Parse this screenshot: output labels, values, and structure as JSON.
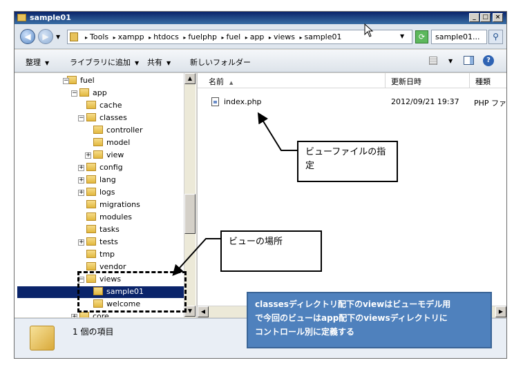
{
  "window": {
    "title": "sample01",
    "controls": [
      "_",
      "□",
      "×"
    ]
  },
  "address": {
    "crumbs": [
      "Tools",
      "xampp",
      "htdocs",
      "fuelphp",
      "fuel",
      "app",
      "views",
      "sample01"
    ],
    "search_text": "sample01..."
  },
  "toolbar": {
    "organize": "整理",
    "add_to_library": "ライブラリに追加",
    "share": "共有",
    "new_folder": "新しいフォルダー"
  },
  "tree": [
    {
      "label": "fuel",
      "expander": "−"
    },
    {
      "label": "app",
      "expander": "−"
    },
    {
      "label": "cache",
      "expander": ""
    },
    {
      "label": "classes",
      "expander": "−"
    },
    {
      "label": "controller",
      "expander": ""
    },
    {
      "label": "model",
      "expander": ""
    },
    {
      "label": "view",
      "expander": "+"
    },
    {
      "label": "config",
      "expander": "+"
    },
    {
      "label": "lang",
      "expander": "+"
    },
    {
      "label": "logs",
      "expander": "+"
    },
    {
      "label": "migrations",
      "expander": ""
    },
    {
      "label": "modules",
      "expander": ""
    },
    {
      "label": "tasks",
      "expander": ""
    },
    {
      "label": "tests",
      "expander": "+"
    },
    {
      "label": "tmp",
      "expander": ""
    },
    {
      "label": "vendor",
      "expander": ""
    },
    {
      "label": "views",
      "expander": "−"
    },
    {
      "label": "sample01",
      "expander": "",
      "selected": true
    },
    {
      "label": "welcome",
      "expander": ""
    },
    {
      "label": "core",
      "expander": "+"
    }
  ],
  "columns": {
    "name": "名前",
    "modified": "更新日時",
    "type": "種類"
  },
  "files": [
    {
      "name": "index.php",
      "modified": "2012/09/21 19:37",
      "type": "PHP ファイ"
    }
  ],
  "status": {
    "item_count": "1 個の項目"
  },
  "annotations": {
    "view_file_line1": "ビューファイルの指",
    "view_file_line2": "定",
    "view_location": "ビューの場所",
    "note_line1": "classesディレクトリ配下のviewはビューモデル用",
    "note_line2": "で今回のビューはapp配下のviewsディレクトリに",
    "note_line3": "コントロール別に定義する"
  },
  "colors": {
    "selection": "#0a246a",
    "note_background": "#4f81bd"
  }
}
